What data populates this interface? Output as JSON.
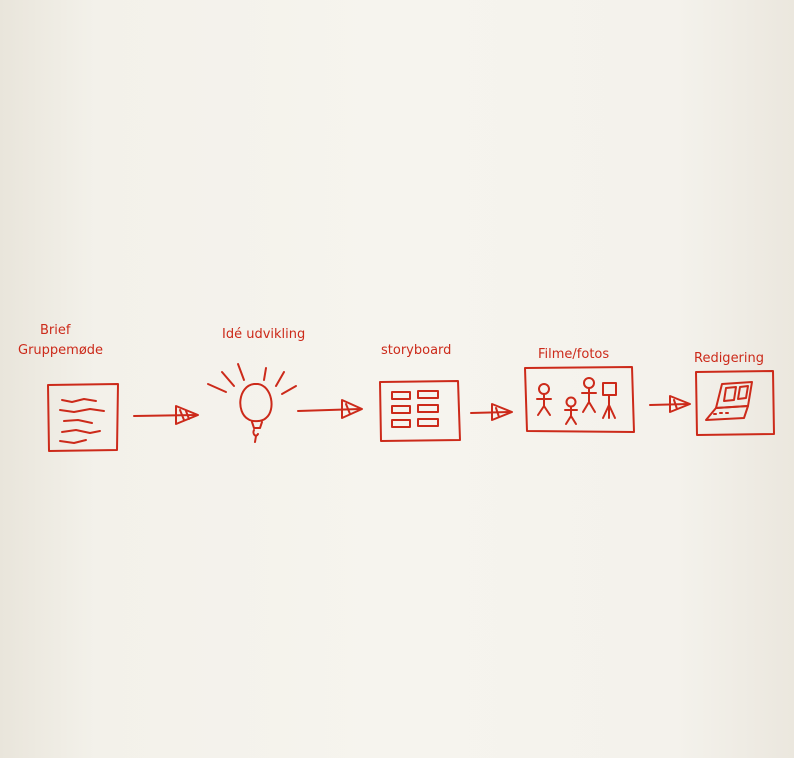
{
  "diagram": {
    "steps": [
      {
        "label_line1": "Brief",
        "label_line2": "Gruppemøde",
        "icon": "document-icon"
      },
      {
        "label_line1": "Idé udvikling",
        "icon": "lightbulb-icon"
      },
      {
        "label_line1": "storyboard",
        "icon": "storyboard-icon"
      },
      {
        "label_line1": "Filme/fotos",
        "icon": "stick-figures-icon"
      },
      {
        "label_line1": "Redigering",
        "icon": "laptop-icon"
      }
    ],
    "connector_icon": "arrow-right-icon",
    "ink_color": "#cc2a1a"
  }
}
